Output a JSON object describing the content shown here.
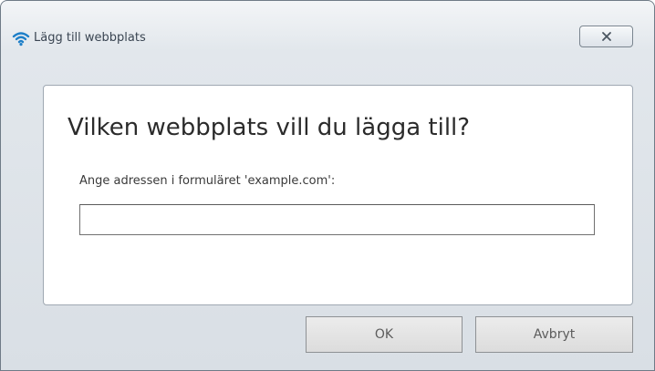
{
  "dialog": {
    "title": "Lägg till webbplats",
    "title_icon": "wifi-icon",
    "close_icon": "close-icon"
  },
  "main": {
    "heading": "Vilken webbplats vill du lägga till?",
    "prompt_label": "Ange adressen i formuläret 'example.com':",
    "url_input": {
      "value": "",
      "placeholder": ""
    }
  },
  "buttons": {
    "ok_label": "OK",
    "cancel_label": "Avbryt"
  },
  "colors": {
    "accent": "#1e7fc8",
    "title_text": "#3a4552",
    "window_border": "#6f7b87"
  }
}
